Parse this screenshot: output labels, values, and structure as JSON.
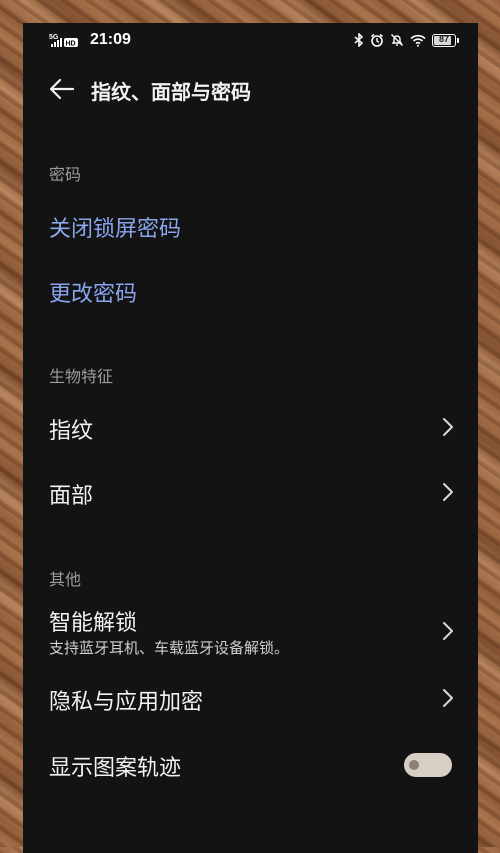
{
  "status_bar": {
    "network": "5G",
    "hd": "HD",
    "time": "21:09",
    "battery": "87",
    "icons": [
      "bluetooth-icon",
      "alarm-icon",
      "bell-off-icon",
      "wifi-icon",
      "battery-icon"
    ]
  },
  "header": {
    "back_icon": "back-arrow-icon",
    "title": "指纹、面部与密码"
  },
  "sections": {
    "password": {
      "title": "密码",
      "items": [
        "关闭锁屏密码",
        "更改密码"
      ]
    },
    "biometrics": {
      "title": "生物特征",
      "items": [
        "指纹",
        "面部"
      ]
    },
    "other": {
      "title": "其他",
      "smart_unlock": "智能解锁",
      "smart_unlock_desc": "支持蓝牙耳机、车载蓝牙设备解锁。",
      "privacy": "隐私与应用加密",
      "pattern_trace": "显示图案轨迹",
      "pattern_trace_on": false
    }
  },
  "colors": {
    "background": "#131313",
    "accent_link": "#8aa4ee",
    "section_header": "#9c9c9c"
  }
}
